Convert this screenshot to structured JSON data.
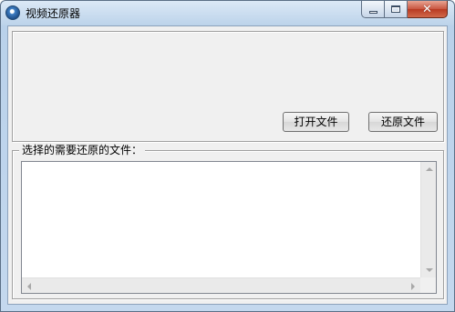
{
  "window": {
    "title": "视频还原器",
    "icon": "app-globe-icon",
    "controls": {
      "minimize_icon": "minimize-icon",
      "maximize_icon": "maximize-icon",
      "close_icon": "close-icon",
      "close_glyph": "✕"
    }
  },
  "toolbar": {
    "open_label": "打开文件",
    "restore_label": "还原文件"
  },
  "files_group": {
    "caption": "选择的需要还原的文件："
  },
  "colors": {
    "close_button": "#c8553f",
    "client_background": "#f0f0f0",
    "title_bar": "#bcd3ea"
  }
}
